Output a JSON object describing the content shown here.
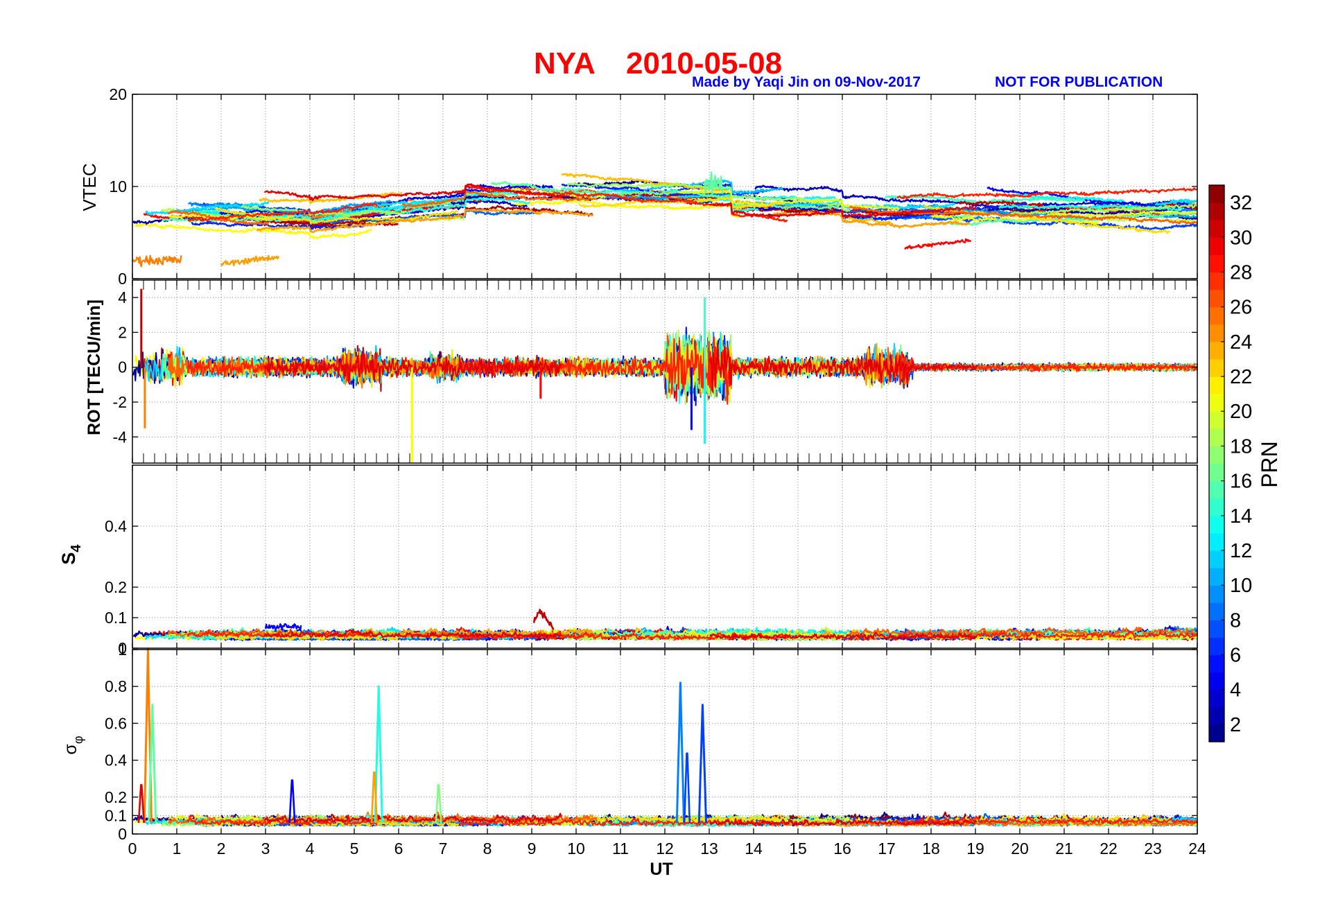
{
  "figure": {
    "title_station": "NYA",
    "title_date": "2010-05-08",
    "credit": "Made by Yaqi Jin on 09-Nov-2017",
    "notice": "NOT FOR PUBLICATION"
  },
  "chart_data": [
    {
      "type": "line",
      "panel": "VTEC",
      "ylabel": "VTEC",
      "ylim": [
        0,
        20
      ],
      "yticks": [
        0,
        10,
        20
      ],
      "xlim": [
        0,
        24
      ],
      "grid": true,
      "color_by": "PRN",
      "series_summary": "multiple PRN traces, mostly between 5 and 12 TECU; maximum about 13 near 13 UT; low traces near 1 to 3 TECU before 4 UT"
    },
    {
      "type": "line",
      "panel": "ROT",
      "ylabel": "ROT [TECU/min]",
      "ylim": [
        -5.5,
        5
      ],
      "yticks": [
        -4,
        -2,
        0,
        2,
        4
      ],
      "xlim": [
        0,
        24
      ],
      "grid": true,
      "color_by": "PRN",
      "series_summary": "fluctuations around 0; largest amplitude (+4 / -4.5) between 12 and 13.5 UT; spike of +4.5 near 0.2 UT and -5.5 near 6.3 UT"
    },
    {
      "type": "line",
      "panel": "S4",
      "ylabel": "S4",
      "ylim": [
        0,
        0.6
      ],
      "yticks": [
        0,
        0.1,
        0.2,
        0.4
      ],
      "xlim": [
        0,
        24
      ],
      "grid": true,
      "color_by": "PRN",
      "series_summary": "amplitude scintillation index mostly 0.02 to 0.08; peak about 0.12 near 9.2 UT"
    },
    {
      "type": "line",
      "panel": "sigma_phi",
      "ylabel": "σφ",
      "ylim": [
        0,
        1
      ],
      "yticks": [
        0,
        0.1,
        0.2,
        0.4,
        0.6,
        0.8,
        1
      ],
      "xlim": [
        0,
        24
      ],
      "xlabel": "UT",
      "xticks": [
        0,
        1,
        2,
        3,
        4,
        5,
        6,
        7,
        8,
        9,
        10,
        11,
        12,
        13,
        14,
        15,
        16,
        17,
        18,
        19,
        20,
        21,
        22,
        23,
        24
      ],
      "grid": true,
      "color_by": "PRN",
      "peaks": [
        {
          "x": 0.35,
          "y": 1.0
        },
        {
          "x": 0.45,
          "y": 0.7
        },
        {
          "x": 5.55,
          "y": 0.8
        },
        {
          "x": 12.35,
          "y": 0.82
        },
        {
          "x": 12.85,
          "y": 0.7
        }
      ],
      "series_summary": "phase scintillation mostly 0.03 to 0.15; peaks near 0.35, 5.55, 12.35 and 12.85 UT"
    }
  ],
  "colorbar": {
    "label": "PRN",
    "ticks": [
      2,
      4,
      6,
      8,
      10,
      12,
      14,
      16,
      18,
      20,
      22,
      24,
      26,
      28,
      30,
      32
    ],
    "range": [
      1,
      33
    ],
    "colormap": "jet"
  }
}
